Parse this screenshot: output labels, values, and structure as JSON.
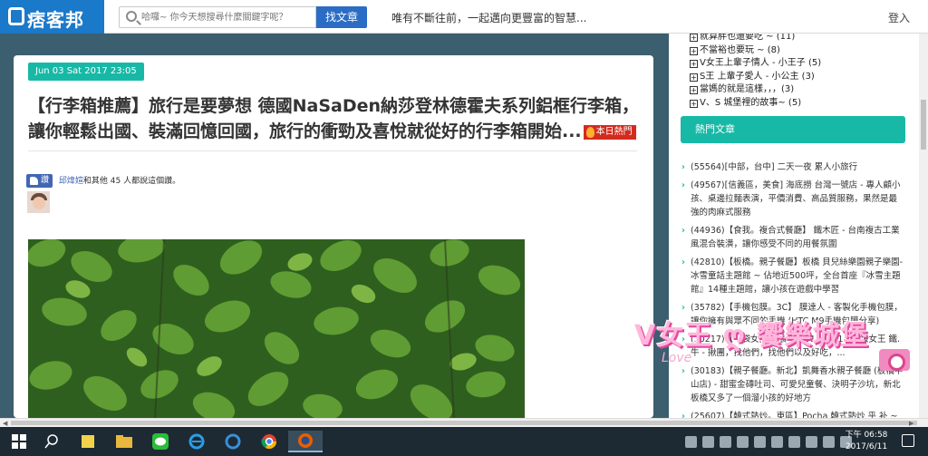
{
  "header": {
    "logo_text": "痞客邦",
    "search_placeholder": "哈囉~ 你今天想搜尋什麼關鍵字呢？",
    "search_button": "找文章",
    "slogan": "唯有不斷往前，一起邁向更豐富的智慧...",
    "login": "登入"
  },
  "article": {
    "date": "Jun 03 Sat 2017 23:05",
    "title": "【行李箱推薦】旅行是要夢想 德國NaSaDen納莎登林德霍夫系列鋁框行李箱，讓你輕鬆出國、裝滿回憶回國，旅行的衝勁及喜悅就從好的行李箱開始...",
    "hot_badge": "本日熱門",
    "like_button": "讚",
    "like_name": "邱煒媗",
    "like_text_mid": "和其他",
    "like_count": "45",
    "like_text_end": "人都說這個讚。"
  },
  "sidebar": {
    "categories": [
      "就算胖也還要吃 ~ (11)",
      "不當裕也要玩 ~ (8)",
      "V女王上輩子情人 - 小王子 (5)",
      "S王 上輩子愛人 - 小公主 (3)",
      "當媽的就是這樣，，，(3)",
      "V、S 城堡裡的故事~ (5)"
    ],
    "hot_title": "熱門文章",
    "hot_articles": [
      "(55564)[中部，台中] 二天一夜 累人小旅行",
      "(49567)[信義區，美食] 海底撈 台灣一號店 - 專人顧小孩、桌邊拉麵表演，平價消費、高品質服務，果然是最強的肉麻式服務",
      "(44936)【食我。複合式餐廳】 鐵木匠 - 台南複古工業風混合裝潢，讓你感受不同的用餐氛圍",
      "(42810)【板橋。親子餐廳】板橋 貝兒絲樂園親子樂園-冰雪童話主題館 ~ 佔地近500坪，全台首座『冰雪主題館』14種主題館，讓小孩在遊戲中學習",
      "(35782)【手機包膜。3C】 膜達人 - 客製化手機包膜，讓你擁有與眾不同的手機 (HTC M9手機包膜分享)",
      "(30217)【ー袋女王 美食】 2015/07/11 一袋女王 鐵.牛 - 揪團，找他們，找他們以及好吃，...",
      "(30183)【親子餐廳。新北】凱舞香水親子餐廳 (板橋中山店) - 甜蜜金磚吐司、可愛兒童餐、決明子沙坑，新北板橋又多了一個溜小孩的好地方",
      "(25607)【韓式熱炒。東區】Pocha 韓式熱炒 乎 补 ~ 台"
    ]
  },
  "watermark": {
    "text": "V女王 ღ 饗樂城堡",
    "sub": "Love"
  },
  "taskbar": {
    "icons": [
      "start-icon",
      "search-icon",
      "sticky-notes-icon",
      "file-explorer-icon",
      "line-icon",
      "ie-icon",
      "edge-icon",
      "chrome-icon",
      "firefox-icon"
    ],
    "time": "下午 06:58",
    "date": "2017/6/11"
  },
  "colors": {
    "logo_blue": "#1b79c9",
    "accent_teal": "#17b9a6",
    "search_button": "#2b6cc4",
    "hot_badge": "#d42b1e",
    "facebook_blue": "#4267b2",
    "watermark_pink": "#ffb7dc"
  }
}
